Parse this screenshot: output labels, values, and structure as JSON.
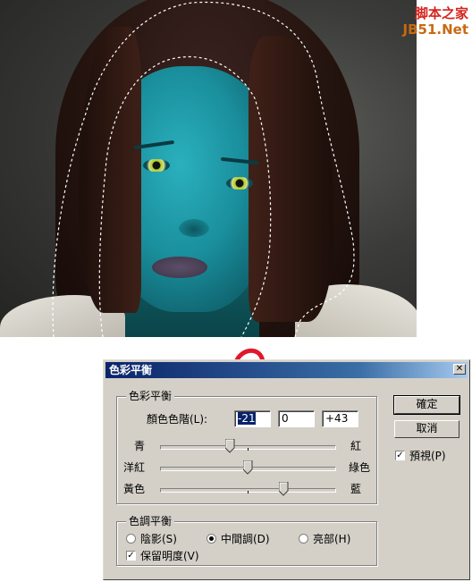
{
  "watermark": {
    "line1": "脚本之家",
    "line2": "JB51.Net"
  },
  "dialog": {
    "title": "色彩平衡",
    "close_glyph": "✕",
    "color_balance_group": {
      "legend": "色彩平衡",
      "levels_label": "顏色色階(L):",
      "levels": [
        "-21",
        "0",
        "+43"
      ],
      "sliders": [
        {
          "left": "青",
          "right": "紅",
          "value": -21
        },
        {
          "left": "洋紅",
          "right": "綠色",
          "value": 0
        },
        {
          "left": "黃色",
          "right": "藍",
          "value": 43
        }
      ]
    },
    "tone_group": {
      "legend": "色調平衡",
      "options": [
        {
          "label": "陰影(S)",
          "selected": false
        },
        {
          "label": "中間調(D)",
          "selected": true
        },
        {
          "label": "亮部(H)",
          "selected": false
        }
      ],
      "preserve_label": "保留明度(V)",
      "preserve_checked": true
    },
    "ok_label": "確定",
    "cancel_label": "取消",
    "preview_label": "預視(P)",
    "preview_checked": true,
    "check_glyph": "✓"
  },
  "colors": {
    "titlebar": "#0a246a",
    "arrow": "#e0182b",
    "skin": "#1a8e9c"
  }
}
